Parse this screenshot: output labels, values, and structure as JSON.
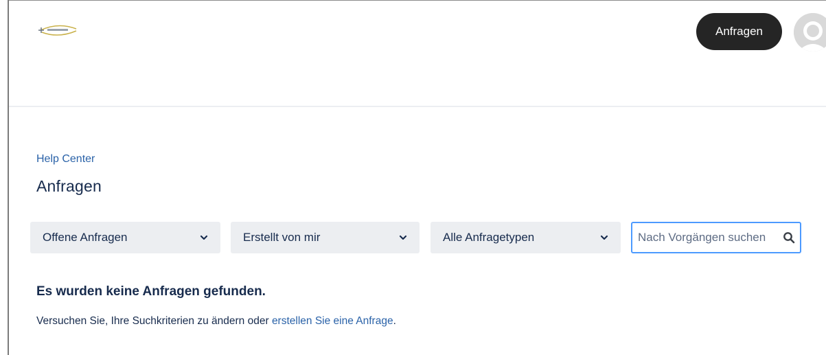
{
  "header": {
    "logo_name": "company-logo",
    "nav_button_label": "Anfragen",
    "avatar_icon": "user-avatar-icon"
  },
  "breadcrumb": {
    "label": "Help Center"
  },
  "page": {
    "title": "Anfragen"
  },
  "filters": [
    {
      "selected": "Offene Anfragen",
      "icon": "chevron-down-icon"
    },
    {
      "selected": "Erstellt von mir",
      "icon": "chevron-down-icon"
    },
    {
      "selected": "Alle Anfragetypen",
      "icon": "chevron-down-icon"
    }
  ],
  "search": {
    "placeholder": "Nach Vorgängen suchen",
    "value": "",
    "icon": "search-icon"
  },
  "empty_state": {
    "heading": "Es wurden keine Anfragen gefunden.",
    "text_before": "Versuchen Sie, Ihre Suchkriterien zu ändern oder ",
    "link": "erstellen Sie eine Anfrage",
    "text_after": "."
  },
  "colors": {
    "accent_link": "#2a62a8",
    "button_dark": "#252525",
    "focus_border": "#4c9aff",
    "filter_bg": "#eceef1"
  }
}
